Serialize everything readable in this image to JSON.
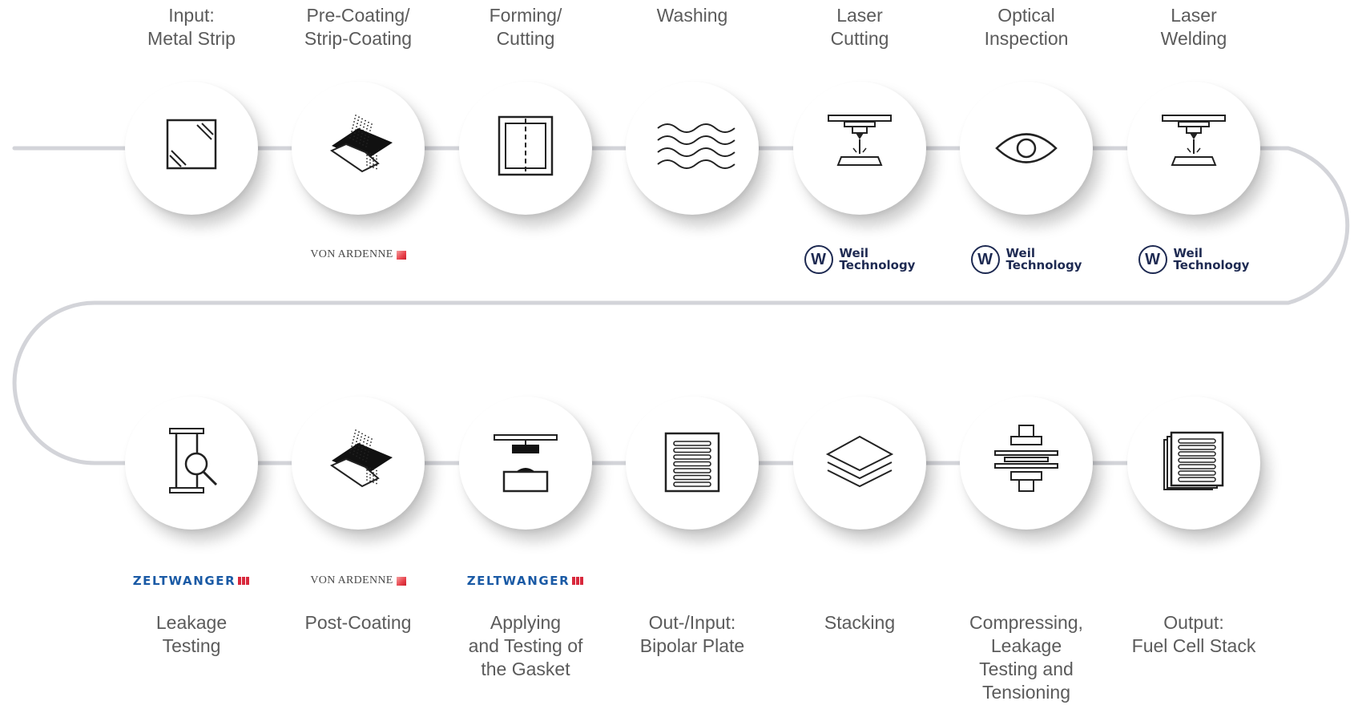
{
  "colors": {
    "line": "#d3d4d9",
    "icon": "#222222",
    "text": "#5b5b5b",
    "weil_navy": "#1e2a52",
    "zeltwanger_blue": "#1a5aa5",
    "zeltwanger_red": "#d8283c",
    "vonardenne_red": "#e8404a"
  },
  "steps": [
    {
      "label": "Input:\nMetal Strip",
      "icon": "metal-strip-icon"
    },
    {
      "label": "Pre-Coating/\nStrip-Coating",
      "icon": "coating-icon",
      "partner": "von-ardenne"
    },
    {
      "label": "Forming/\nCutting",
      "icon": "forming-cutting-icon"
    },
    {
      "label": "Washing",
      "icon": "washing-waves-icon"
    },
    {
      "label": "Laser\nCutting",
      "icon": "laser-icon",
      "partner": "weil"
    },
    {
      "label": "Optical\nInspection",
      "icon": "eye-icon",
      "partner": "weil"
    },
    {
      "label": "Laser\nWelding",
      "icon": "laser-icon",
      "partner": "weil"
    },
    {
      "label": "Leakage\nTesting",
      "icon": "leakage-test-icon",
      "partner": "zeltwanger"
    },
    {
      "label": "Post-Coating",
      "icon": "coating-icon",
      "partner": "von-ardenne"
    },
    {
      "label": "Applying\nand Testing of\nthe Gasket",
      "icon": "gasket-press-icon",
      "partner": "zeltwanger"
    },
    {
      "label": "Out-/Input:\nBipolar Plate",
      "icon": "bipolar-plate-icon"
    },
    {
      "label": "Stacking",
      "icon": "stacking-layers-icon"
    },
    {
      "label": "Compressing,\nLeakage\nTesting and\nTensioning",
      "icon": "compress-press-icon"
    },
    {
      "label": "Output:\nFuel Cell Stack",
      "icon": "fuel-cell-stack-icon"
    }
  ],
  "partners": {
    "von_ardenne": "VON ARDENNE",
    "weil": {
      "mark": "W",
      "name": "Weil\nTechnology"
    },
    "zeltwanger": "ZELTWANGER"
  }
}
